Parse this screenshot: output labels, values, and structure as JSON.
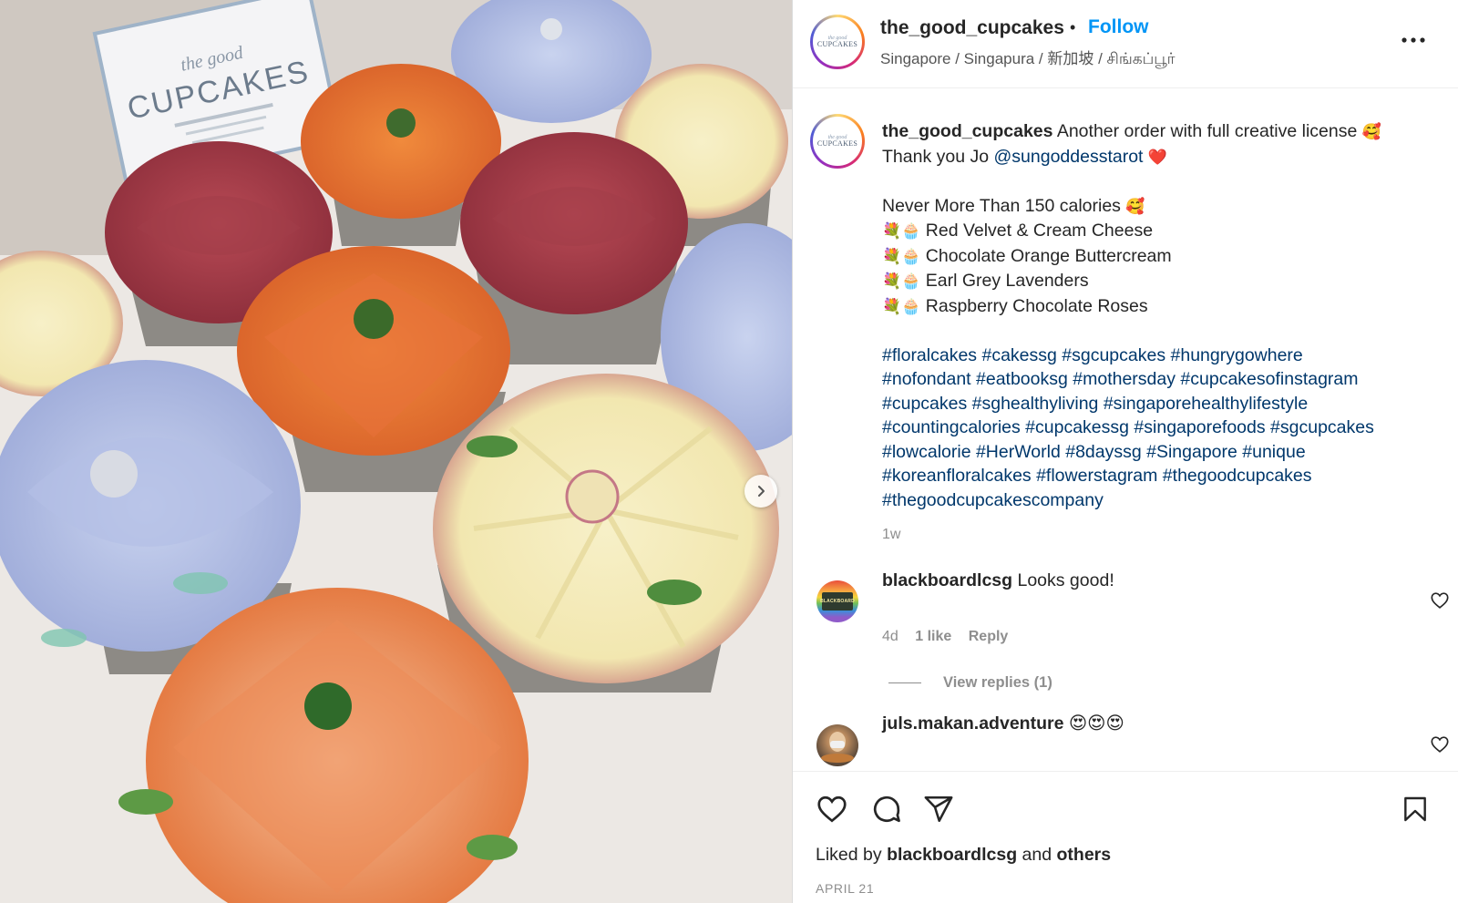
{
  "post": {
    "username": "the_good_cupcakes",
    "separator": "•",
    "follow_label": "Follow",
    "location": "Singapore / Singapura / 新加坡 / சிங்கப்பூர்",
    "avatar_text_top": "the good",
    "avatar_text_bottom": "CUPCAKES",
    "box_label_top": "the good",
    "box_label_main": "CUPCAKES"
  },
  "caption": {
    "username": "the_good_cupcakes",
    "line1_text": " Another order with full creative license ",
    "line1_emoji": "🥰",
    "line2_prefix": "Thank you Jo ",
    "mention": "@sungoddesstarot",
    "line2_emoji": " ❤️",
    "calories_text": "Never More Than 150 calories ",
    "calories_emoji": "🥰",
    "bullet_emoji": "💐🧁",
    "flavors": [
      " Red Velvet & Cream Cheese",
      " Chocolate Orange Buttercream",
      " Earl Grey Lavenders",
      " Raspberry Chocolate Roses"
    ],
    "hashtag_lines": [
      "#floralcakes #cakessg #sgcupcakes #hungrygowhere",
      "#nofondant #eatbooksg #mothersday #cupcakesofinstagram",
      "#cupcakes #sghealthyliving #singaporehealthylifestyle",
      "#countingcalories #cupcakessg #singaporefoods #sgcupcakes",
      "#lowcalorie #HerWorld #8dayssg #Singapore #unique",
      "#koreanfloralcakes #flowerstagram #thegoodcupcakes",
      "#thegoodcupcakescompany"
    ],
    "time": "1w"
  },
  "comments": [
    {
      "username": "blackboardlcsg",
      "text": " Looks good!",
      "time": "4d",
      "likes": "1 like",
      "reply_label": "Reply",
      "view_replies": "View replies (1)",
      "avatar_text": "BLACKBOARD"
    },
    {
      "username": "juls.makan.adventure",
      "text": " 😍😍😍"
    }
  ],
  "footer": {
    "liked_by_prefix": "Liked by ",
    "liked_by_user": "blackboardlcsg",
    "liked_by_and": " and ",
    "liked_by_others": "others",
    "date": "APRIL 21"
  },
  "colors": {
    "link": "#00376b",
    "follow": "#0095f6",
    "muted": "#8e8e8e"
  },
  "icons": {
    "next": "chevron-right-icon",
    "more": "more-options-icon",
    "like": "heart-icon",
    "comment": "comment-icon",
    "share": "paper-plane-icon",
    "save": "bookmark-icon"
  }
}
